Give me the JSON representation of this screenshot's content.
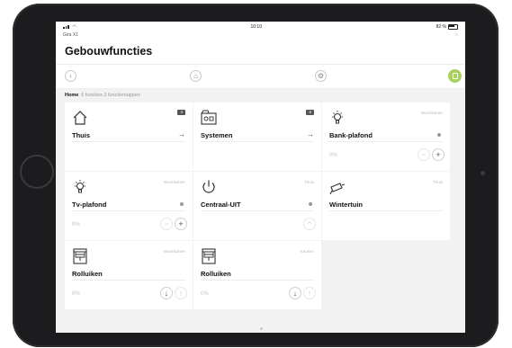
{
  "status": {
    "carrier": "",
    "time": "10:10",
    "battery": "82 %"
  },
  "app": {
    "name": "Gira X1"
  },
  "page": {
    "title": "Gebouwfuncties"
  },
  "breadcrumb": {
    "home": "Home",
    "info": "6 functies 2 functiemappen"
  },
  "tiles": [
    {
      "name": "Thuis",
      "badge": "3",
      "icon": "house-icon",
      "kind": "folder"
    },
    {
      "name": "Systemen",
      "badge": "6",
      "icon": "systems-icon",
      "kind": "folder"
    },
    {
      "name": "Bank-plafond",
      "room": "Woonkamer",
      "icon": "bulb-icon",
      "kind": "dimmer",
      "percent": "0%",
      "buttons": [
        "−",
        "+"
      ]
    },
    {
      "name": "Tv-plafond",
      "room": "Woonkamer",
      "icon": "bulb-icon",
      "kind": "dimmer",
      "percent": "0%",
      "buttons": [
        "−",
        "+"
      ]
    },
    {
      "name": "Centraal-UIT",
      "room": "Thuis",
      "icon": "power-icon",
      "kind": "switch",
      "buttons": [
        "^"
      ]
    },
    {
      "name": "Wintertuin",
      "room": "Thuis",
      "icon": "camera-icon",
      "kind": "plain"
    },
    {
      "name": "Rolluiken",
      "room": "Woonkamer",
      "icon": "blind-icon",
      "kind": "shutter",
      "percent": "0%",
      "buttons": [
        "↓",
        "↑"
      ]
    },
    {
      "name": "Rolluiken",
      "room": "Keuken",
      "icon": "blind-icon",
      "kind": "shutter",
      "percent": "0%",
      "buttons": [
        "↓",
        "↑"
      ]
    }
  ],
  "colors": {
    "accent": "#a8d05a",
    "badge": "#555555"
  }
}
